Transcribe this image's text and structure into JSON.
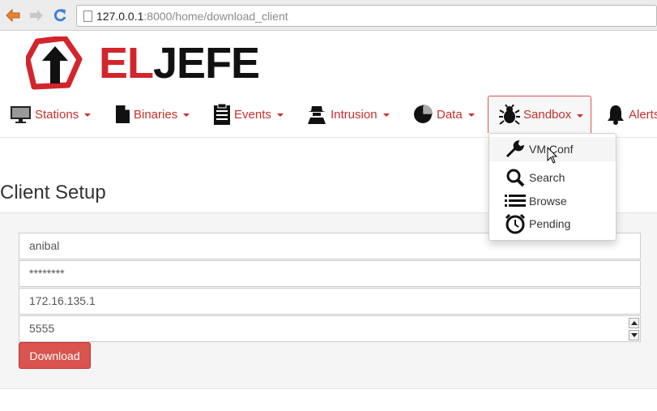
{
  "browser": {
    "url_host": "127.0.0.1",
    "url_path": ":8000/home/download_client"
  },
  "logo": {
    "text_el": "EL",
    "text_jefe": "JEFE"
  },
  "nav": {
    "items": [
      {
        "label": "Stations",
        "icon": "monitor-icon"
      },
      {
        "label": "Binaries",
        "icon": "file-icon"
      },
      {
        "label": "Events",
        "icon": "clipboard-icon"
      },
      {
        "label": "Intrusion",
        "icon": "spy-icon"
      },
      {
        "label": "Data",
        "icon": "pie-chart-icon"
      },
      {
        "label": "Sandbox",
        "icon": "bug-icon"
      },
      {
        "label": "Alerts",
        "icon": "bell-icon"
      }
    ],
    "active": "Sandbox"
  },
  "dropdown": {
    "items": [
      {
        "label": "VM Conf",
        "icon": "wrench-icon"
      },
      {
        "label": "Search",
        "icon": "search-icon"
      },
      {
        "label": "Browse",
        "icon": "list-icon"
      },
      {
        "label": "Pending",
        "icon": "alarm-clock-icon"
      }
    ],
    "hovered": "VM Conf"
  },
  "page": {
    "title": "Client Setup"
  },
  "form": {
    "username": "anibal",
    "password": "********",
    "ip": "172.16.135.1",
    "port": "5555",
    "submit_label": "Download"
  },
  "colors": {
    "accent": "#d9534f",
    "nav_text": "#c9302c",
    "logo_red": "#d2262c"
  }
}
